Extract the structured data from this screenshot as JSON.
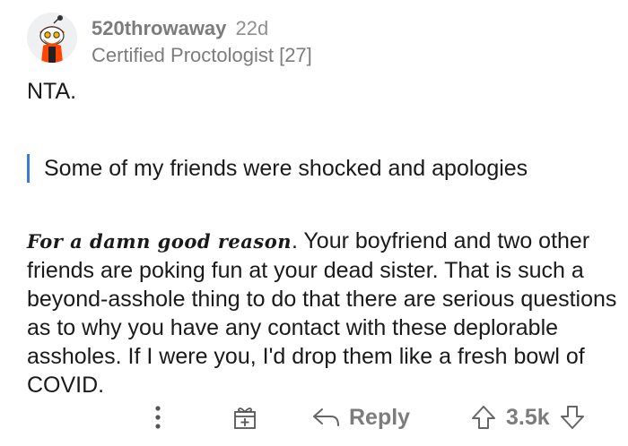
{
  "comment": {
    "author": "520throwaway",
    "age": "22d",
    "flair": "Certified Proctologist [27]",
    "verdict": "NTA.",
    "quote": "Some of my friends were shocked and apologies",
    "emphasis": "For a damn good reason",
    "body_rest": ". Your boyfriend and two other friends are poking fun at your dead sister. That is such a beyond-asshole thing to do that there are serious questions as to why you have any contact with these deplorable assholes. If I were you, I'd drop them like a fresh bowl of COVID."
  },
  "actions": {
    "reply_label": "Reply",
    "score": "3.5k"
  },
  "colors": {
    "meta_text": "#7c7c7c",
    "quote_bar": "#3a7bd5",
    "avatar_accent": "#ff4500"
  },
  "icons": {
    "more": "more-options-icon",
    "award": "award-icon",
    "reply": "reply-arrow-icon",
    "upvote": "upvote-arrow-icon",
    "downvote": "downvote-arrow-icon"
  }
}
